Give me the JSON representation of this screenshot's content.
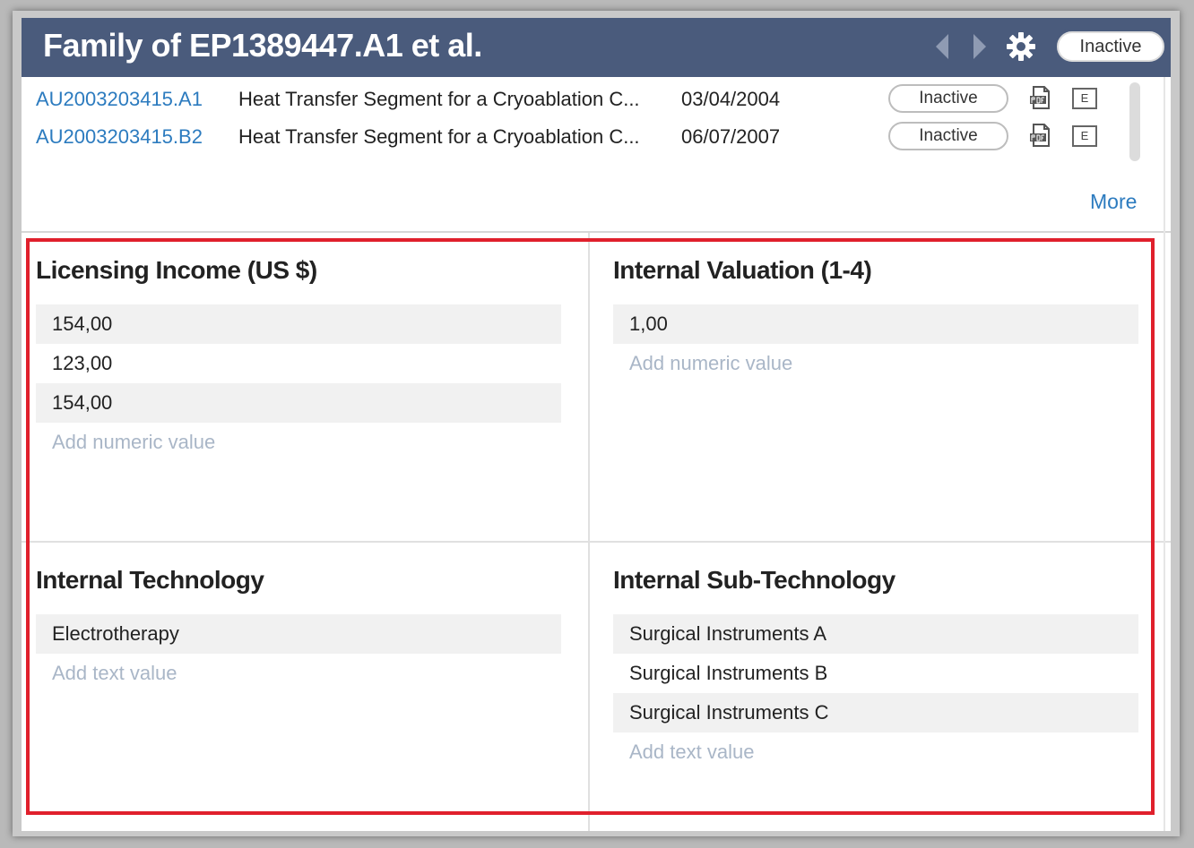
{
  "header": {
    "title": "Family of EP1389447.A1 et al.",
    "status": "Inactive"
  },
  "family_members": [
    {
      "number": "AU2003203415.A1",
      "title": "Heat Transfer Segment for a Cryoablation C...",
      "date": "03/04/2004",
      "status": "Inactive",
      "e_label": "E"
    },
    {
      "number": "AU2003203415.B2",
      "title": "Heat Transfer Segment for a Cryoablation C...",
      "date": "06/07/2007",
      "status": "Inactive",
      "e_label": "E"
    }
  ],
  "more_label": "More",
  "fields": {
    "licensing_income": {
      "title": "Licensing Income (US $)",
      "values": [
        "154,00",
        "123,00",
        "154,00"
      ],
      "add_placeholder": "Add numeric value"
    },
    "internal_valuation": {
      "title": "Internal Valuation (1-4)",
      "values": [
        "1,00"
      ],
      "add_placeholder": "Add numeric value"
    },
    "internal_technology": {
      "title": "Internal Technology",
      "values": [
        "Electrotherapy"
      ],
      "add_placeholder": "Add text value"
    },
    "internal_sub_technology": {
      "title": "Internal Sub-Technology",
      "values": [
        "Surgical Instruments A",
        "Surgical Instruments B",
        "Surgical Instruments C"
      ],
      "add_placeholder": "Add text value"
    }
  },
  "colors": {
    "header_bg": "#4a5b7c",
    "link": "#2c7bbf",
    "highlight": "#e0202c",
    "placeholder": "#a9b6c7"
  },
  "icons": [
    "chevron-left-icon",
    "chevron-right-icon",
    "gear-icon",
    "pdf-icon"
  ]
}
